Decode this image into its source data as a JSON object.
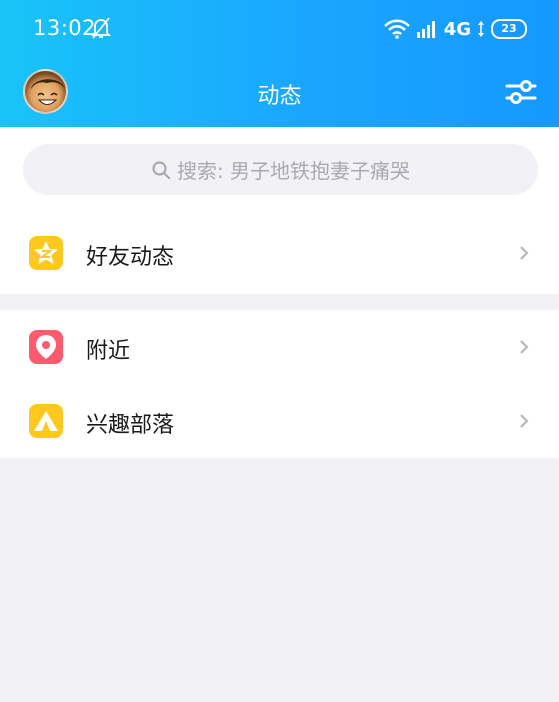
{
  "status_bar": {
    "time": "13:02",
    "network": "4G",
    "battery": "23"
  },
  "header": {
    "title": "动态"
  },
  "search": {
    "placeholder": "搜索: 男子地铁抱妻子痛哭"
  },
  "sections": {
    "friends_feed": {
      "label": "好友动态",
      "icon": "qzone-star-icon",
      "color": "#ffc81e"
    },
    "nearby": {
      "label": "附近",
      "icon": "location-pin-icon",
      "color": "#ff5a6e"
    },
    "interest_tribe": {
      "label": "兴趣部落",
      "icon": "tent-icon",
      "color": "#ffc81e"
    }
  },
  "colors": {
    "header_start": "#19c4f8",
    "header_end": "#1598ff",
    "page_bg": "#f2f2f6"
  }
}
